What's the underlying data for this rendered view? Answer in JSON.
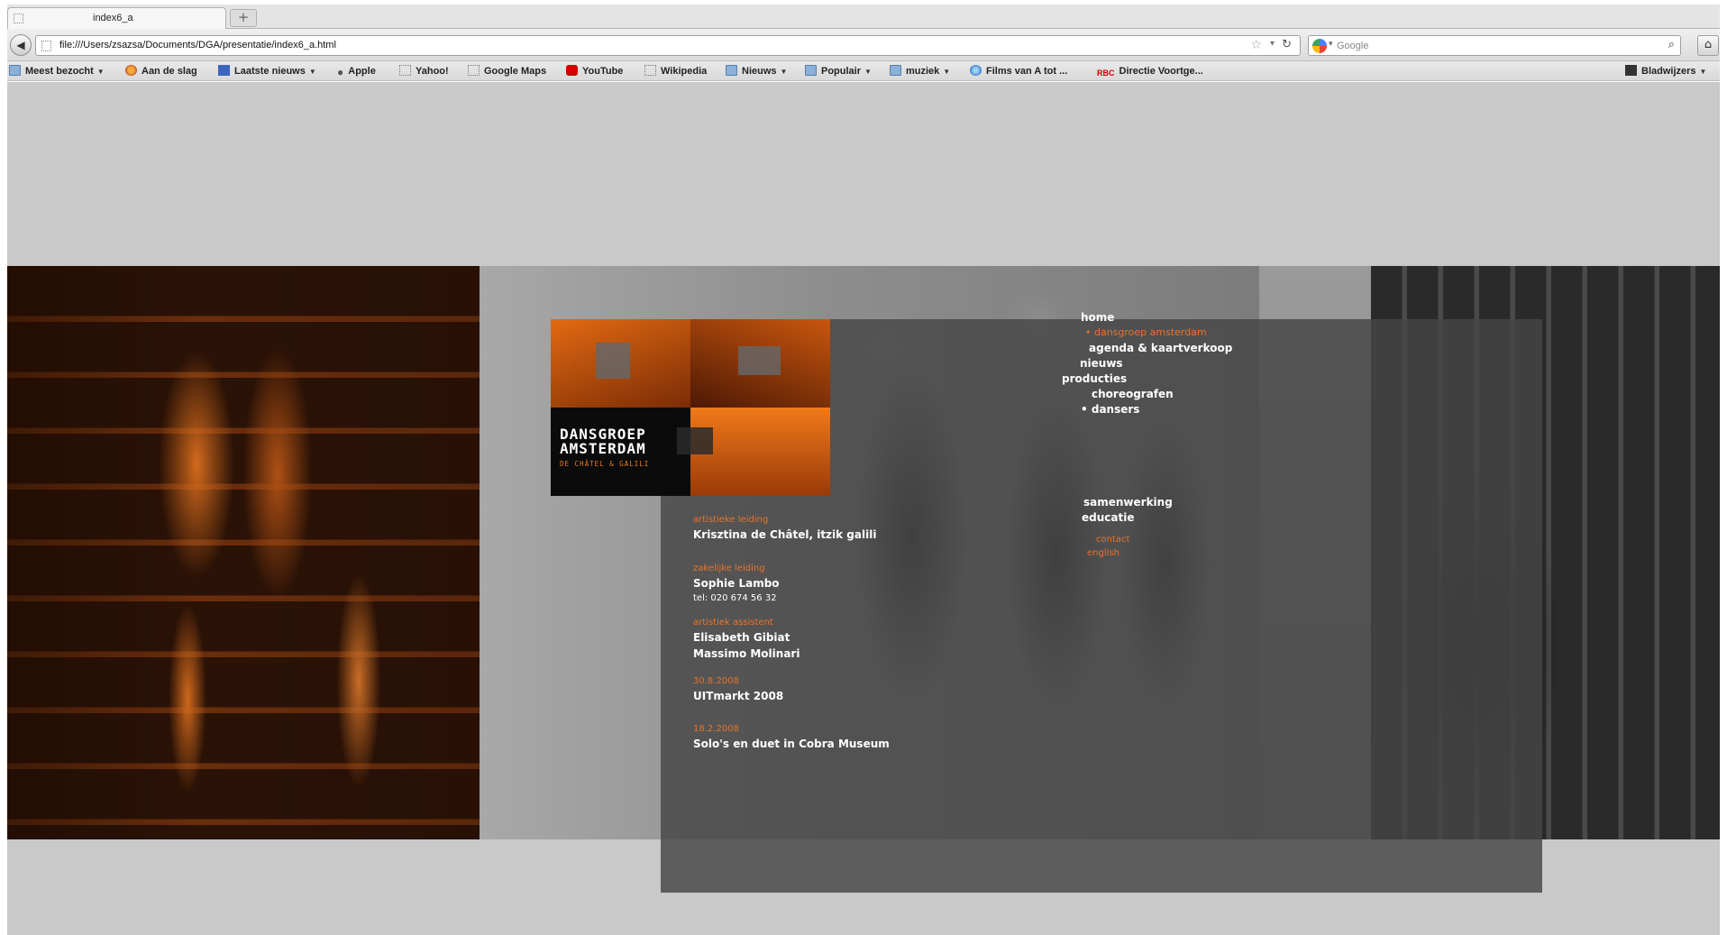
{
  "browser": {
    "tab_title": "index6_a",
    "new_tab_label": "+",
    "url": "file:///Users/zsazsa/Documents/DGA/presentatie/index6_a.html",
    "search_placeholder": "Google",
    "bookmarks": [
      {
        "label": "Meest bezocht",
        "icon": "folder-icon",
        "dropdown": true
      },
      {
        "label": "Aan de slag",
        "icon": "firefox-icon",
        "dropdown": false
      },
      {
        "label": "Laatste nieuws",
        "icon": "rss-icon",
        "dropdown": true
      },
      {
        "label": "Apple",
        "icon": "apple-icon",
        "dropdown": false
      },
      {
        "label": "Yahoo!",
        "icon": "page-icon",
        "dropdown": false
      },
      {
        "label": "Google Maps",
        "icon": "page-icon",
        "dropdown": false
      },
      {
        "label": "YouTube",
        "icon": "youtube-icon",
        "dropdown": false
      },
      {
        "label": "Wikipedia",
        "icon": "page-icon",
        "dropdown": false
      },
      {
        "label": "Nieuws",
        "icon": "folder-icon",
        "dropdown": true
      },
      {
        "label": "Populair",
        "icon": "folder-icon",
        "dropdown": true
      },
      {
        "label": "muziek",
        "icon": "folder-icon",
        "dropdown": true
      },
      {
        "label": "Films van A tot ...",
        "icon": "globe-icon",
        "dropdown": false
      },
      {
        "label": "Directie Voortge...",
        "icon": "rbc-icon",
        "dropdown": false
      }
    ],
    "bookmarks_menu_label": "Bladwijzers"
  },
  "site": {
    "logo": {
      "title_line1": "DANSGROEP",
      "title_line2": "AMSTERDAM",
      "subtitle": "DE CHÂTEL & GALILI"
    },
    "nav": {
      "home": "home",
      "dansgroep": "• dansgroep amsterdam",
      "agenda": "agenda & kaartverkoop",
      "nieuws": "nieuws",
      "producties": "producties",
      "choreografen": "choreografen",
      "dansers": "• dansers",
      "samenwerking": "samenwerking",
      "educatie": "educatie",
      "contact": "contact",
      "english": "english"
    },
    "info": {
      "artistieke_leiding_label": "artistieke leiding",
      "artistieke_leiding_value": "Krisztina de Châtel, itzik galili",
      "zakelijke_leiding_label": "zakelijke leiding",
      "zakelijke_leiding_value": "Sophie Lambo",
      "tel": "tel:  020 674 56 32",
      "artistiek_assistent_label": "artistiek assistent",
      "assistent_1": "Elisabeth Gibiat",
      "assistent_2": "Massimo Molinari",
      "date_1": "30.8.2008",
      "event_1": "UITmarkt 2008",
      "date_2": "18.2.2008",
      "event_2": "Solo's en duet in Cobra Museum"
    }
  },
  "colors": {
    "accent_orange": "#e8742a",
    "page_bg": "#c9c9c9",
    "panel_dark": "#464646"
  }
}
